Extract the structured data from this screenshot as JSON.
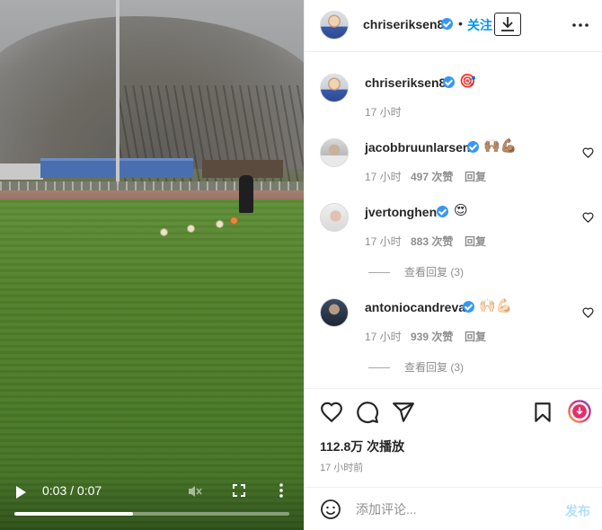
{
  "video": {
    "time_label": "0:03 / 0:07",
    "progress": 0.43
  },
  "post": {
    "author": "chriseriksen8",
    "follow_label": "关注",
    "caption_emoji": "🎯",
    "caption_time": "17 小时",
    "plays": "112.8万 次播放",
    "posted": "17 小时前"
  },
  "comments": [
    {
      "username": "jacobbruunlarsen",
      "emoji": "🙌🏽💪🏽",
      "time": "17 小时",
      "likes": "497 次赞",
      "reply_label": "回复",
      "view_replies": ""
    },
    {
      "username": "jvertonghen",
      "emoji": "😍",
      "time": "17 小时",
      "likes": "883 次赞",
      "reply_label": "回复",
      "view_replies": "查看回复 (3)"
    },
    {
      "username": "antoniocandreva",
      "emoji": "🙌🏻💪🏻",
      "time": "17 小时",
      "likes": "939 次赞",
      "reply_label": "回复",
      "view_replies": "查看回复 (3)"
    }
  ],
  "comment_box": {
    "placeholder": "添加评论...",
    "publish_label": "发布"
  },
  "colors": {
    "accent": "#0095f6",
    "verified": "#3897f0",
    "muted_text": "#8e8e8e"
  },
  "icons": [
    "play-icon",
    "mute-icon",
    "fullscreen-icon",
    "more-vert-icon",
    "verified-icon",
    "download-icon",
    "more-icon",
    "heart-icon",
    "comment-icon",
    "share-icon",
    "bookmark-icon",
    "reel-icon",
    "emoji-icon"
  ]
}
